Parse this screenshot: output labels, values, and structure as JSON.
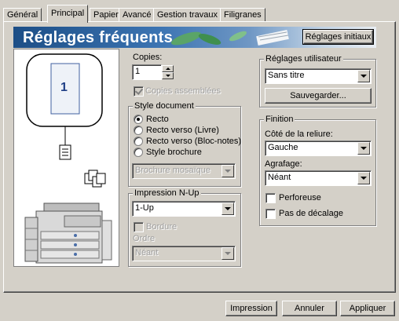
{
  "tabs": [
    {
      "label": "Général",
      "active": false
    },
    {
      "label": "Principal",
      "active": true
    },
    {
      "label": "Papier",
      "active": false
    },
    {
      "label": "Avancé",
      "active": false
    },
    {
      "label": "Gestion travaux",
      "active": false
    },
    {
      "label": "Filigranes",
      "active": false
    }
  ],
  "banner": {
    "title": "Réglages fréquents",
    "initial_settings_button": "Réglages initiaux"
  },
  "preview": {
    "page_number": "1"
  },
  "copies": {
    "label": "Copies:",
    "value": "1",
    "collate_label": "Copies assemblées",
    "collate_checked": true,
    "collate_enabled": false
  },
  "document_style": {
    "legend": "Style document",
    "options": [
      "Recto",
      "Recto verso (Livre)",
      "Recto verso (Bloc-notes)",
      "Style brochure"
    ],
    "selected": "Recto",
    "brochure_select": "Brochure mosaïque"
  },
  "n_up": {
    "legend": "Impression N-Up",
    "value": "1-Up",
    "border_label": "Bordure",
    "order_label": "Ordre",
    "order_value": "Néant"
  },
  "user_settings": {
    "legend": "Réglages utilisateur",
    "value": "Sans titre",
    "save_button": "Sauvegarder..."
  },
  "finishing": {
    "legend": "Finition",
    "binding_label": "Côté de la reliure:",
    "binding_value": "Gauche",
    "stapling_label": "Agrafage:",
    "stapling_value": "Néant",
    "punch_label": "Perforeuse",
    "offset_label": "Pas de décalage"
  },
  "footer": {
    "print_button": "Impression",
    "cancel_button": "Annuler",
    "apply_button": "Appliquer"
  }
}
